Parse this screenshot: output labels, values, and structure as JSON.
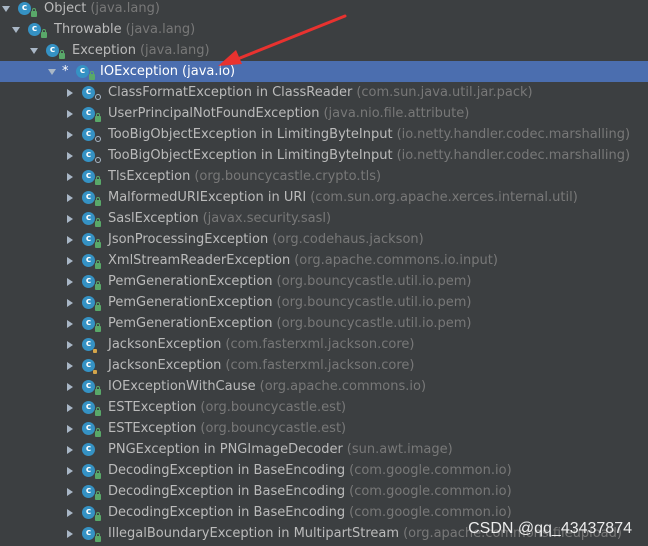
{
  "tree": {
    "root": {
      "name": "Object",
      "pkg": "(java.lang)"
    },
    "throwable": {
      "name": "Throwable",
      "pkg": "(java.lang)"
    },
    "exception": {
      "name": "Exception",
      "pkg": "(java.lang)"
    },
    "ioexception": {
      "marker": "*",
      "name": "IOException",
      "pkg": "(java.io)"
    },
    "children": [
      {
        "name": "ClassFormatException in ClassReader",
        "pkg": "(com.sun.java.util.jar.pack)",
        "badge": "dot"
      },
      {
        "name": "UserPrincipalNotFoundException",
        "pkg": "(java.nio.file.attribute)",
        "badge": "lock"
      },
      {
        "name": "TooBigObjectException in LimitingByteInput",
        "pkg": "(io.netty.handler.codec.marshalling)",
        "badge": "dot"
      },
      {
        "name": "TooBigObjectException in LimitingByteInput",
        "pkg": "(io.netty.handler.codec.marshalling)",
        "badge": "dot"
      },
      {
        "name": "TlsException",
        "pkg": "(org.bouncycastle.crypto.tls)",
        "badge": "lock"
      },
      {
        "name": "MalformedURIException in URI",
        "pkg": "(com.sun.org.apache.xerces.internal.util)",
        "badge": "lock"
      },
      {
        "name": "SaslException",
        "pkg": "(javax.security.sasl)",
        "badge": "lock"
      },
      {
        "name": "JsonProcessingException",
        "pkg": "(org.codehaus.jackson)",
        "badge": "lock"
      },
      {
        "name": "XmlStreamReaderException",
        "pkg": "(org.apache.commons.io.input)",
        "badge": "lock"
      },
      {
        "name": "PemGenerationException",
        "pkg": "(org.bouncycastle.util.io.pem)",
        "badge": "lock"
      },
      {
        "name": "PemGenerationException",
        "pkg": "(org.bouncycastle.util.io.pem)",
        "badge": "lock"
      },
      {
        "name": "PemGenerationException",
        "pkg": "(org.bouncycastle.util.io.pem)",
        "badge": "lock"
      },
      {
        "name": "JacksonException",
        "pkg": "(com.fasterxml.jackson.core)",
        "badge": "excl"
      },
      {
        "name": "JacksonException",
        "pkg": "(com.fasterxml.jackson.core)",
        "badge": "excl"
      },
      {
        "name": "IOExceptionWithCause",
        "pkg": "(org.apache.commons.io)",
        "badge": "lock"
      },
      {
        "name": "ESTException",
        "pkg": "(org.bouncycastle.est)",
        "badge": "lock"
      },
      {
        "name": "ESTException",
        "pkg": "(org.bouncycastle.est)",
        "badge": "lock"
      },
      {
        "name": "PNGException in PNGImageDecoder",
        "pkg": "(sun.awt.image)",
        "badge": "none"
      },
      {
        "name": "DecodingException in BaseEncoding",
        "pkg": "(com.google.common.io)",
        "badge": "lock"
      },
      {
        "name": "DecodingException in BaseEncoding",
        "pkg": "(com.google.common.io)",
        "badge": "lock"
      },
      {
        "name": "DecodingException in BaseEncoding",
        "pkg": "(com.google.common.io)",
        "badge": "lock"
      },
      {
        "name": "IllegalBoundaryException in MultipartStream",
        "pkg": "(org.apache.commons.fileupload)",
        "badge": "lock"
      }
    ]
  },
  "watermark": "CSDN @qq_43437874",
  "colors": {
    "background": "#3c3f41",
    "selection": "#4b6eaf",
    "class_icon": "#3592c4",
    "annotation_arrow": "#e8322f"
  }
}
